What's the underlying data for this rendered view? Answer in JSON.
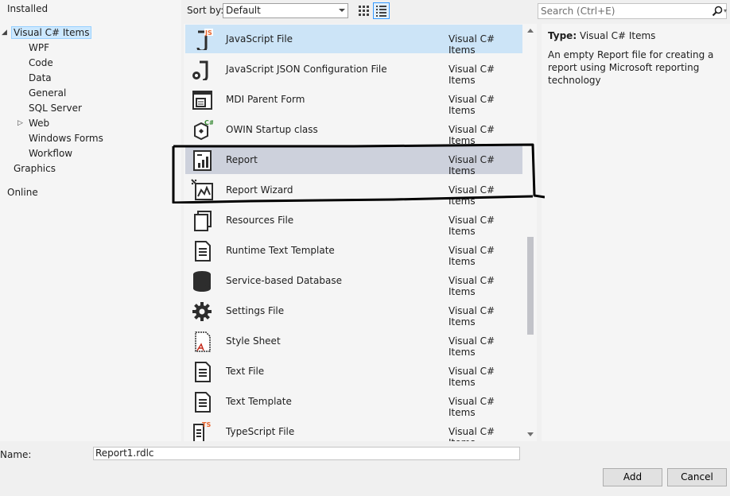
{
  "tree": {
    "installed": "Installed",
    "visual_csharp": "Visual C# Items",
    "wpf": "WPF",
    "code": "Code",
    "data": "Data",
    "general": "General",
    "sql_server": "SQL Server",
    "web": "Web",
    "windows_forms": "Windows Forms",
    "workflow": "Workflow",
    "graphics": "Graphics",
    "online": "Online"
  },
  "toolbar": {
    "sort_label": "Sort by:",
    "sort_value": "Default",
    "search_placeholder": "Search (Ctrl+E)"
  },
  "items": [
    {
      "name": "JavaScript File",
      "category": "Visual C# Items",
      "icon": "javascript-file-icon"
    },
    {
      "name": "JavaScript JSON Configuration File",
      "category": "Visual C# Items",
      "icon": "json-config-icon"
    },
    {
      "name": "MDI Parent Form",
      "category": "Visual C# Items",
      "icon": "mdi-form-icon"
    },
    {
      "name": "OWIN Startup class",
      "category": "Visual C# Items",
      "icon": "owin-class-icon"
    },
    {
      "name": "Report",
      "category": "Visual C# Items",
      "icon": "report-icon"
    },
    {
      "name": "Report Wizard",
      "category": "Visual C# Items",
      "icon": "report-wizard-icon"
    },
    {
      "name": "Resources File",
      "category": "Visual C# Items",
      "icon": "resources-file-icon"
    },
    {
      "name": "Runtime Text Template",
      "category": "Visual C# Items",
      "icon": "text-template-icon"
    },
    {
      "name": "Service-based Database",
      "category": "Visual C# Items",
      "icon": "database-icon"
    },
    {
      "name": "Settings File",
      "category": "Visual C# Items",
      "icon": "gear-icon"
    },
    {
      "name": "Style Sheet",
      "category": "Visual C# Items",
      "icon": "style-sheet-icon"
    },
    {
      "name": "Text File",
      "category": "Visual C# Items",
      "icon": "text-file-icon"
    },
    {
      "name": "Text Template",
      "category": "Visual C# Items",
      "icon": "text-template-icon"
    },
    {
      "name": "TypeScript File",
      "category": "Visual C# Items",
      "icon": "typescript-file-icon"
    }
  ],
  "details": {
    "type_label": "Type:",
    "type_value": "Visual C# Items",
    "description": "An empty Report file for creating a report using Microsoft reporting technology"
  },
  "footer": {
    "name_label": "Name:",
    "name_value": "Report1.rdlc",
    "add_label": "Add",
    "cancel_label": "Cancel"
  },
  "colors": {
    "selected_row": "#cce4f7",
    "hover_row": "#cdd1dc",
    "annotation": "#000000",
    "js_badge": "#e8632b"
  }
}
